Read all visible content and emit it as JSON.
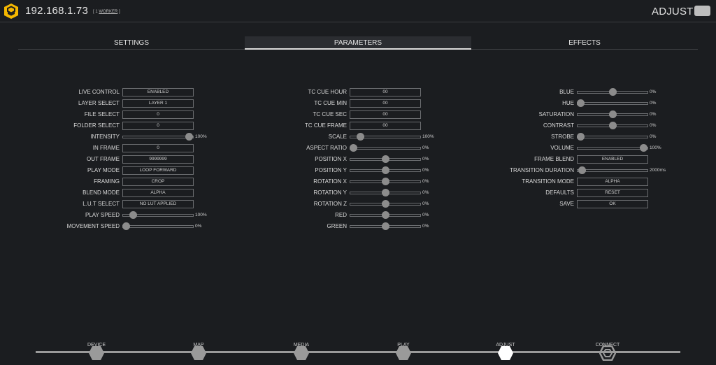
{
  "header": {
    "ip": "192.168.1.73",
    "worker_prefix": "[ 1 ",
    "worker_link": "WORKER",
    "worker_suffix": " ]",
    "page_title": "ADJUST",
    "logo_icon": "shield-logo-icon",
    "menu_icon": "menu-toggle-icon",
    "accent": "#f5b800"
  },
  "tabs": [
    {
      "label": "SETTINGS",
      "active": false
    },
    {
      "label": "PARAMETERS",
      "active": true
    },
    {
      "label": "EFFECTS",
      "active": false
    }
  ],
  "col1": [
    {
      "label": "LIVE CONTROL",
      "type": "field",
      "value": "ENABLED"
    },
    {
      "label": "LAYER SELECT",
      "type": "field",
      "value": "LAYER 1"
    },
    {
      "label": "FILE SELECT",
      "type": "field",
      "value": "0"
    },
    {
      "label": "FOLDER SELECT",
      "type": "field",
      "value": "0"
    },
    {
      "label": "INTENSITY",
      "type": "slider",
      "value": "100%",
      "pos": 0.94
    },
    {
      "label": "IN FRAME",
      "type": "field",
      "value": "0"
    },
    {
      "label": "OUT FRAME",
      "type": "field",
      "value": "9999999"
    },
    {
      "label": "PLAY MODE",
      "type": "field",
      "value": "LOOP FORWARD"
    },
    {
      "label": "FRAMING",
      "type": "field",
      "value": "CROP"
    },
    {
      "label": "BLEND MODE",
      "type": "field",
      "value": "ALPHA"
    },
    {
      "label": "L.U.T SELECT",
      "type": "field",
      "value": "NO LUT APPLIED"
    },
    {
      "label": "PLAY SPEED",
      "type": "slider",
      "value": "100%",
      "pos": 0.15
    },
    {
      "label": "MOVEMENT SPEED",
      "type": "slider",
      "value": "0%",
      "pos": 0.05
    }
  ],
  "col2": [
    {
      "label": "TC CUE HOUR",
      "type": "field",
      "value": "00"
    },
    {
      "label": "TC CUE MIN",
      "type": "field",
      "value": "00"
    },
    {
      "label": "TC CUE SEC",
      "type": "field",
      "value": "00"
    },
    {
      "label": "TC CUE FRAME",
      "type": "field",
      "value": "00"
    },
    {
      "label": "SCALE",
      "type": "slider",
      "value": "100%",
      "pos": 0.15
    },
    {
      "label": "ASPECT RATIO",
      "type": "slider",
      "value": "0%",
      "pos": 0.05
    },
    {
      "label": "POSITION X",
      "type": "slider",
      "value": "0%",
      "pos": 0.5
    },
    {
      "label": "POSITION Y",
      "type": "slider",
      "value": "0%",
      "pos": 0.5
    },
    {
      "label": "ROTATION X",
      "type": "slider",
      "value": "0%",
      "pos": 0.5
    },
    {
      "label": "ROTATION Y",
      "type": "slider",
      "value": "0%",
      "pos": 0.5
    },
    {
      "label": "ROTATION Z",
      "type": "slider",
      "value": "0%",
      "pos": 0.5
    },
    {
      "label": "RED",
      "type": "slider",
      "value": "0%",
      "pos": 0.5
    },
    {
      "label": "GREEN",
      "type": "slider",
      "value": "0%",
      "pos": 0.5
    }
  ],
  "col3": [
    {
      "label": "BLUE",
      "type": "slider",
      "value": "0%",
      "pos": 0.5
    },
    {
      "label": "HUE",
      "type": "slider",
      "value": "0%",
      "pos": 0.05
    },
    {
      "label": "SATURATION",
      "type": "slider",
      "value": "0%",
      "pos": 0.5
    },
    {
      "label": "CONTRAST",
      "type": "slider",
      "value": "0%",
      "pos": 0.5
    },
    {
      "label": "STROBE",
      "type": "slider",
      "value": "0%",
      "pos": 0.05
    },
    {
      "label": "VOLUME",
      "type": "slider",
      "value": "100%",
      "pos": 0.94
    },
    {
      "label": "FRAME BLEND",
      "type": "field",
      "value": "ENABLED"
    },
    {
      "label": "TRANSITION DURATION",
      "type": "slider",
      "value": "2000ms",
      "pos": 0.07
    },
    {
      "label": "TRANSITION MODE",
      "type": "field",
      "value": "ALPHA"
    },
    {
      "label": "DEFAULTS",
      "type": "field",
      "value": "RESET"
    },
    {
      "label": "SAVE",
      "type": "field",
      "value": "OK"
    }
  ],
  "nav": [
    {
      "label": "DEVICE",
      "state": "normal"
    },
    {
      "label": "MAP",
      "state": "normal"
    },
    {
      "label": "MEDIA",
      "state": "normal"
    },
    {
      "label": "PLAY",
      "state": "normal"
    },
    {
      "label": "ADJUST",
      "state": "active"
    },
    {
      "label": "CONNECT",
      "state": "connect"
    }
  ]
}
